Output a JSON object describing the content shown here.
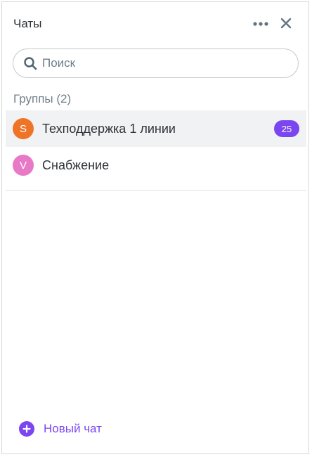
{
  "header": {
    "title": "Чаты",
    "more_icon": "more-horizontal-icon",
    "close_icon": "close-icon"
  },
  "search": {
    "placeholder": "Поиск",
    "value": "",
    "icon": "search-icon"
  },
  "groups": {
    "label": "Группы (2)",
    "items": [
      {
        "name": "Техподдержка 1 линии",
        "avatar_letter": "S",
        "avatar_color": "#f07427",
        "badge": "25",
        "active": true
      },
      {
        "name": "Снабжение",
        "avatar_letter": "V",
        "avatar_color": "#e879c6",
        "badge": "",
        "active": false
      }
    ]
  },
  "footer": {
    "new_chat_label": "Новый чат",
    "icon": "plus-circle-icon"
  },
  "colors": {
    "accent": "#7b46f0",
    "text": "#2f3337",
    "muted": "#71808a",
    "icon": "#5f7480",
    "active_row": "#f0f2f4"
  }
}
